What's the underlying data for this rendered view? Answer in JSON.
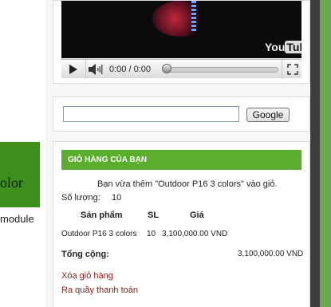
{
  "left": {
    "green_text": "olor",
    "caption": "module"
  },
  "video": {
    "logo_you": "You",
    "logo_tube": "Tube",
    "time": "0:00 / 0:00",
    "progress": 0
  },
  "search": {
    "value": "",
    "button": "Google"
  },
  "cart": {
    "header": "GIỎ HÀNG CỦA BẠN",
    "added_message": "Bạn vừa thêm \"Outdoor P16 3 colors\" vào giỏ.",
    "quantity_label": "Số lượng:",
    "quantity_value": "10",
    "columns": {
      "product": "Sản phẩm",
      "qty": "SL",
      "price": "Giá"
    },
    "row": {
      "product": "Outdoor P16 3 colors",
      "qty": "10",
      "price": "3,100,000.00 VND"
    },
    "total_label": "Tổng cộng:",
    "total_value": "3,100,000.00 VND",
    "links": {
      "clear": "Xóa giỏ hàng",
      "checkout": "Ra quầy thanh toán"
    }
  },
  "colors": {
    "cart_header": "#5aad2d",
    "left_block": "#3f8f1f",
    "link": "#8b1a1a"
  }
}
